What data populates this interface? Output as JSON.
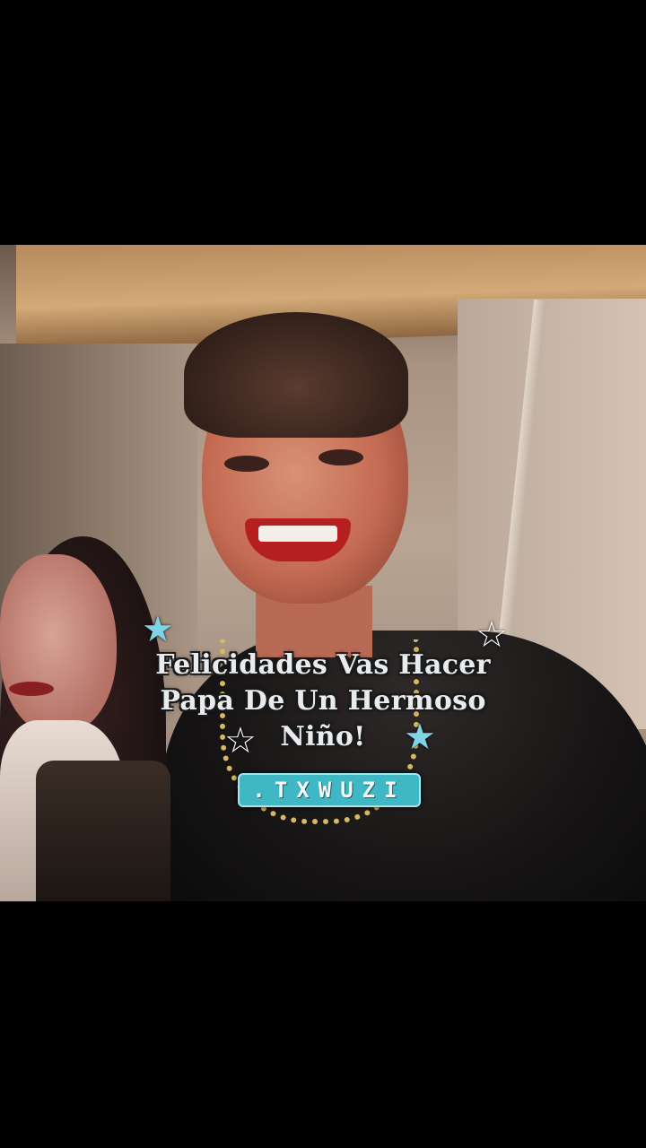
{
  "caption": {
    "line1": "Felicidades  Vas Hacer",
    "line2": "Papa De Un Hermoso",
    "line3": "Niño!"
  },
  "badge": {
    "text": ".TXWUZI"
  },
  "stars": {
    "top_left_color": "#7fd3e6",
    "top_right_color": "#ffffff",
    "bottom_left_color": "#ffffff",
    "bottom_right_color": "#7fd3e6"
  }
}
